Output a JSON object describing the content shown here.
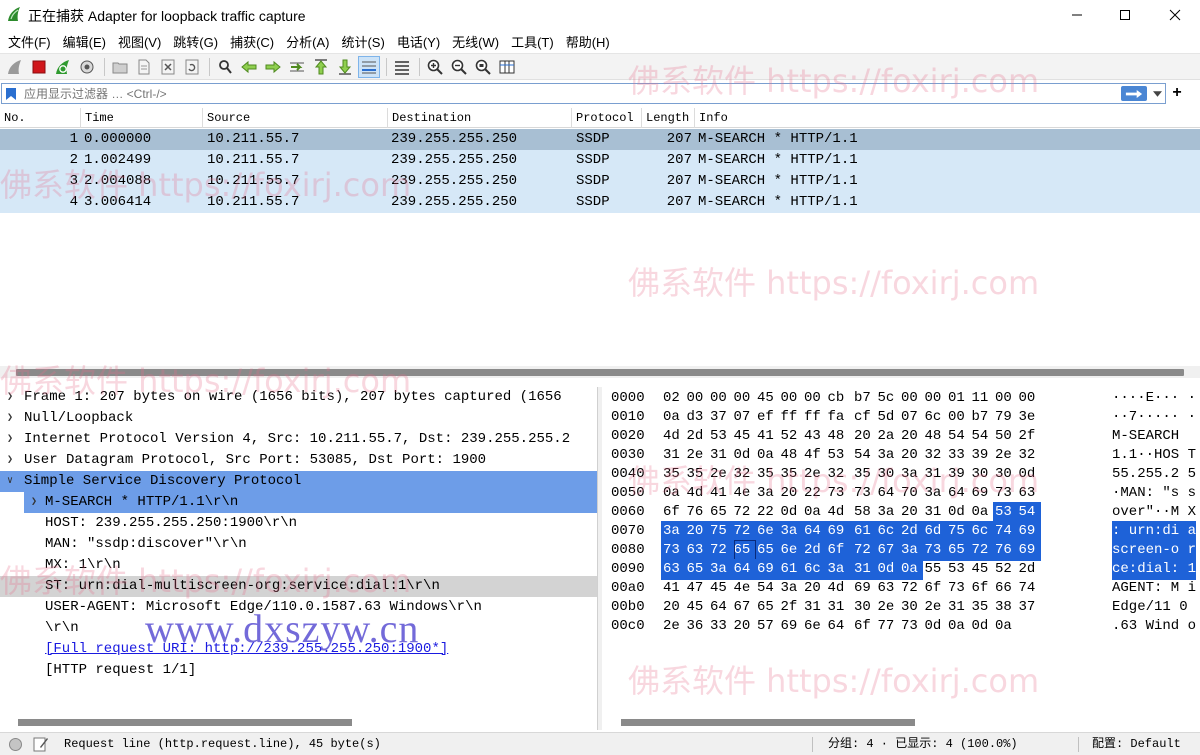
{
  "window": {
    "title": "正在捕获 Adapter for loopback traffic capture"
  },
  "menu": [
    "文件(F)",
    "编辑(E)",
    "视图(V)",
    "跳转(G)",
    "捕获(C)",
    "分析(A)",
    "统计(S)",
    "电话(Y)",
    "无线(W)",
    "工具(T)",
    "帮助(H)"
  ],
  "filter": {
    "placeholder": "应用显示过滤器 … <Ctrl-/>"
  },
  "packet_list": {
    "columns": [
      "No.",
      "Time",
      "Source",
      "Destination",
      "Protocol",
      "Length",
      "Info"
    ],
    "rows": [
      {
        "no": "1",
        "time": "0.000000",
        "source": "10.211.55.7",
        "destination": "239.255.255.250",
        "protocol": "SSDP",
        "length": "207",
        "info": "M-SEARCH * HTTP/1.1"
      },
      {
        "no": "2",
        "time": "1.002499",
        "source": "10.211.55.7",
        "destination": "239.255.255.250",
        "protocol": "SSDP",
        "length": "207",
        "info": "M-SEARCH * HTTP/1.1"
      },
      {
        "no": "3",
        "time": "2.004088",
        "source": "10.211.55.7",
        "destination": "239.255.255.250",
        "protocol": "SSDP",
        "length": "207",
        "info": "M-SEARCH * HTTP/1.1"
      },
      {
        "no": "4",
        "time": "3.006414",
        "source": "10.211.55.7",
        "destination": "239.255.255.250",
        "protocol": "SSDP",
        "length": "207",
        "info": "M-SEARCH * HTTP/1.1"
      }
    ]
  },
  "details": {
    "lines": [
      "Frame 1: 207 bytes on wire (1656 bits), 207 bytes captured (1656",
      "Null/Loopback",
      "Internet Protocol Version 4, Src: 10.211.55.7, Dst: 239.255.255.2",
      "User Datagram Protocol, Src Port: 53085, Dst Port: 1900",
      "Simple Service Discovery Protocol",
      "M-SEARCH * HTTP/1.1\\r\\n",
      "HOST: 239.255.255.250:1900\\r\\n",
      "MAN: \"ssdp:discover\"\\r\\n",
      "MX: 1\\r\\n",
      "ST: urn:dial-multiscreen-org:service:dial:1\\r\\n",
      "USER-AGENT: Microsoft Edge/110.0.1587.63 Windows\\r\\n",
      "\\r\\n",
      "[Full request URI: http://239.255.255.250:1900*]",
      "[HTTP request 1/1]"
    ]
  },
  "hex": {
    "rows": [
      {
        "off": "0000",
        "bytes": [
          "02",
          "00",
          "00",
          "00",
          "45",
          "00",
          "00",
          "cb",
          "b7",
          "5c",
          "00",
          "00",
          "01",
          "11",
          "00",
          "00"
        ],
        "ascii": "····E··· ·"
      },
      {
        "off": "0010",
        "bytes": [
          "0a",
          "d3",
          "37",
          "07",
          "ef",
          "ff",
          "ff",
          "fa",
          "cf",
          "5d",
          "07",
          "6c",
          "00",
          "b7",
          "79",
          "3e"
        ],
        "ascii": "··7····· ·"
      },
      {
        "off": "0020",
        "bytes": [
          "4d",
          "2d",
          "53",
          "45",
          "41",
          "52",
          "43",
          "48",
          "20",
          "2a",
          "20",
          "48",
          "54",
          "54",
          "50",
          "2f"
        ],
        "ascii": "M-SEARCH"
      },
      {
        "off": "0030",
        "bytes": [
          "31",
          "2e",
          "31",
          "0d",
          "0a",
          "48",
          "4f",
          "53",
          "54",
          "3a",
          "20",
          "32",
          "33",
          "39",
          "2e",
          "32"
        ],
        "ascii": "1.1··HOS T"
      },
      {
        "off": "0040",
        "bytes": [
          "35",
          "35",
          "2e",
          "32",
          "35",
          "35",
          "2e",
          "32",
          "35",
          "30",
          "3a",
          "31",
          "39",
          "30",
          "30",
          "0d"
        ],
        "ascii": "55.255.2 5"
      },
      {
        "off": "0050",
        "bytes": [
          "0a",
          "4d",
          "41",
          "4e",
          "3a",
          "20",
          "22",
          "73",
          "73",
          "64",
          "70",
          "3a",
          "64",
          "69",
          "73",
          "63"
        ],
        "ascii": "·MAN: \"s s"
      },
      {
        "off": "0060",
        "bytes": [
          "6f",
          "76",
          "65",
          "72",
          "22",
          "0d",
          "0a",
          "4d",
          "58",
          "3a",
          "20",
          "31",
          "0d",
          "0a",
          "53",
          "54"
        ],
        "ascii": "over\"··M X"
      },
      {
        "off": "0070",
        "bytes": [
          "3a",
          "20",
          "75",
          "72",
          "6e",
          "3a",
          "64",
          "69",
          "61",
          "6c",
          "2d",
          "6d",
          "75",
          "6c",
          "74",
          "69"
        ],
        "ascii": ": urn:di a"
      },
      {
        "off": "0080",
        "bytes": [
          "73",
          "63",
          "72",
          "65",
          "65",
          "6e",
          "2d",
          "6f",
          "72",
          "67",
          "3a",
          "73",
          "65",
          "72",
          "76",
          "69"
        ],
        "ascii": "screen-o r"
      },
      {
        "off": "0090",
        "bytes": [
          "63",
          "65",
          "3a",
          "64",
          "69",
          "61",
          "6c",
          "3a",
          "31",
          "0d",
          "0a",
          "55",
          "53",
          "45",
          "52",
          "2d"
        ],
        "ascii": "ce:dial: 1"
      },
      {
        "off": "00a0",
        "bytes": [
          "41",
          "47",
          "45",
          "4e",
          "54",
          "3a",
          "20",
          "4d",
          "69",
          "63",
          "72",
          "6f",
          "73",
          "6f",
          "66",
          "74"
        ],
        "ascii": "AGENT: M i"
      },
      {
        "off": "00b0",
        "bytes": [
          "20",
          "45",
          "64",
          "67",
          "65",
          "2f",
          "31",
          "31",
          "30",
          "2e",
          "30",
          "2e",
          "31",
          "35",
          "38",
          "37"
        ],
        "ascii": " Edge/11 0"
      },
      {
        "off": "00c0",
        "bytes": [
          "2e",
          "36",
          "33",
          "20",
          "57",
          "69",
          "6e",
          "64",
          "6f",
          "77",
          "73",
          "0d",
          "0a",
          "0d",
          "0a"
        ],
        "ascii": ".63 Wind o"
      }
    ]
  },
  "status": {
    "field": "Request line (http.request.line), 45 byte(s)",
    "packets": "分组: 4 · 已显示: 4 (100.0%)",
    "profile": "配置: Default"
  },
  "watermarks": {
    "text": "佛系软件 https://foxirj.com",
    "site": "www.dxszyw.cn"
  },
  "colors": {
    "row_bg": "#d6e8f7",
    "row_selected": "#a8bfd3",
    "tree_selected": "#6d9de8",
    "hex_selected": "#1e62d8"
  }
}
